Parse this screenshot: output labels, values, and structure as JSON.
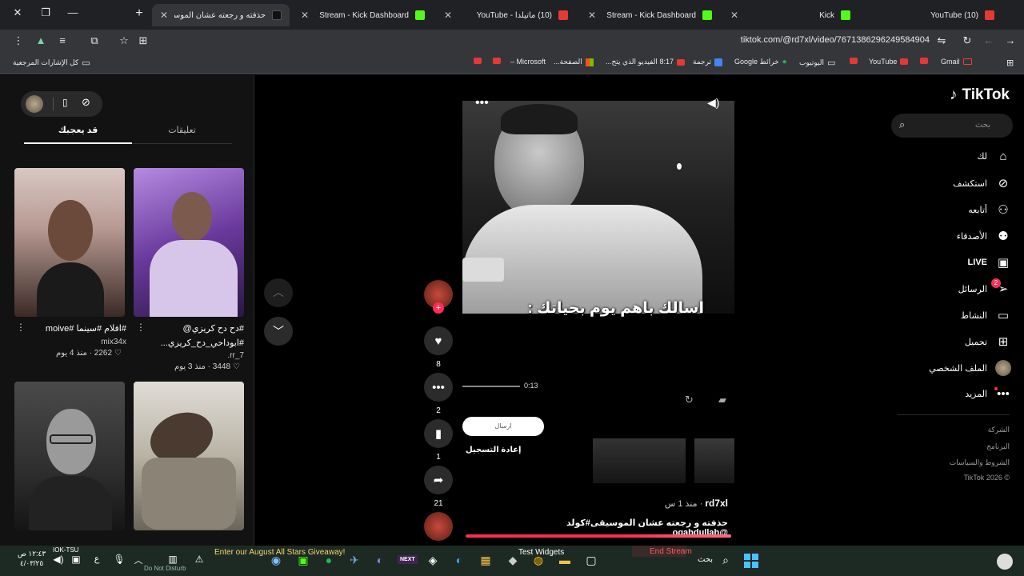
{
  "browser": {
    "tabs": [
      {
        "label": "(10) YouTube",
        "icon_color": "#e53935"
      },
      {
        "label": "Kick",
        "icon_color": "#53fc18"
      },
      {
        "label": "Stream - Kick Dashboard",
        "icon_color": "#53fc18"
      },
      {
        "label": "(10) ماتيلدا - YouTube",
        "icon_color": "#e53935"
      },
      {
        "label": "Stream - Kick Dashboard",
        "icon_color": "#53fc18"
      },
      {
        "label": "حذفته و رجعته عشان الموسيقى#...",
        "icon_color": "#000000"
      }
    ],
    "url": "tiktok.com/@rd7xl/video/7671386296249584904",
    "bookmarks": [
      {
        "label": "Gmail"
      },
      {
        "label": ""
      },
      {
        "label": "YouTube"
      },
      {
        "label": ""
      },
      {
        "label": "اليوتيوب"
      },
      {
        "label": "خرائط Google"
      },
      {
        "label": "ترجمة"
      },
      {
        "label": "8:17 الفيديو الذي يتح..."
      },
      {
        "label": "الصفحة..."
      },
      {
        "label": "Microsoft –"
      },
      {
        "label": ""
      },
      {
        "label": ""
      }
    ],
    "all_bookmarks_label": "كل الإشارات المرجعية"
  },
  "tiktok": {
    "logo": "TikTok",
    "search_placeholder": "بحث",
    "nav": [
      {
        "label": "لك",
        "icon": "home-icon"
      },
      {
        "label": "استكشف",
        "icon": "compass-icon"
      },
      {
        "label": "أتابعه",
        "icon": "user-follow-icon"
      },
      {
        "label": "الأصدقاء",
        "icon": "friends-icon"
      },
      {
        "label": "LIVE",
        "icon": "live-icon"
      },
      {
        "label": "الرسائل",
        "icon": "send-icon",
        "badge": "2"
      },
      {
        "label": "النشاط",
        "icon": "activity-icon"
      },
      {
        "label": "تحميل",
        "icon": "upload-icon"
      },
      {
        "label": "الملف الشخصي",
        "icon": "avatar"
      },
      {
        "label": "المزيد",
        "icon": "more-icon"
      }
    ],
    "footer": [
      "الشركة",
      "البرنامج",
      "الشروط والسياسات",
      "© 2026 TikTok"
    ],
    "video": {
      "caption_overlay": "اسالك باهم يوم بحياتك :",
      "time": "0:13",
      "send_label": "ارسال",
      "replay_label": "إعادة التسجيل",
      "author": "rd7xl",
      "posted": "منذ 1 س",
      "description": "حذفته و رجعته عشان الموسيقى#كولد @ogabdullah"
    },
    "actions": {
      "likes": "8",
      "comments": "2",
      "saves": "1",
      "shares": "21"
    },
    "panel": {
      "tab_comments": "تعليقات",
      "tab_you_may_like": "قد يعجبك",
      "cards": [
        {
          "title": "#دح دح كريزي@",
          "subtitle": "#ابوداحي_دح_كريزي...",
          "author": "rr_7.",
          "likes": "3448",
          "age": "منذ 3 يوم"
        },
        {
          "title": "#افلام #سينما #moive",
          "subtitle": "",
          "author": "mix34x",
          "likes": "2262",
          "age": "منذ 4 يوم"
        },
        {
          "title": "",
          "subtitle": "",
          "author": "",
          "likes": "",
          "age": ""
        },
        {
          "title": "",
          "subtitle": "",
          "author": "",
          "likes": "",
          "age": ""
        }
      ]
    }
  },
  "taskbar": {
    "time": "١٢:٤٣ ص",
    "date": "٤/٠٣/٢٥",
    "giveaway": "Enter our August All Stars Giveaway!",
    "test_widgets": "Test Widgets",
    "end_stream": "End Stream",
    "search_label": "بحث",
    "news": "IOK-TSU",
    "dnd": "Do Not Disturb"
  }
}
